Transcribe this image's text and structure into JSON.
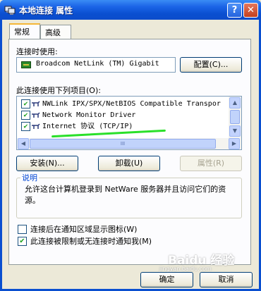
{
  "window": {
    "title": "本地连接 属性",
    "help_glyph": "?",
    "close_glyph": "✕"
  },
  "tabs": [
    {
      "label": "常规",
      "active": true
    },
    {
      "label": "高级",
      "active": false
    }
  ],
  "connect_using": {
    "label": "连接时使用:",
    "device_name": "Broadcom NetLink (TM) Gigabit",
    "configure_button": "配置(C)..."
  },
  "items": {
    "label": "此连接使用下列项目(O):",
    "list": [
      {
        "checked": true,
        "text": "NWLink IPX/SPX/NetBIOS Compatible Transpor"
      },
      {
        "checked": true,
        "text": "Network Monitor Driver"
      },
      {
        "checked": true,
        "text": "Internet 协议 (TCP/IP)"
      }
    ]
  },
  "scroll": {
    "up": "▲",
    "down": "▼",
    "left": "◀",
    "right": "▶",
    "grip": "III"
  },
  "buttons": {
    "install": "安装(N)...",
    "uninstall": "卸载(U)",
    "properties": "属性(R)"
  },
  "description": {
    "title": "说明",
    "text": "允许这台计算机登录到 NetWare 服务器并且访问它们的资源。"
  },
  "options": [
    {
      "checked": false,
      "label": "连接后在通知区域显示图标(W)"
    },
    {
      "checked": true,
      "label": "此连接被限制或无连接时通知我(M)"
    }
  ],
  "footer": {
    "ok": "确定",
    "cancel": "取消"
  },
  "watermark": {
    "text": "Baidu 经验",
    "url": "jingyan.baidu.com"
  },
  "colors": {
    "titlebar": "#0a4fd0",
    "annotation": "#2ae02a",
    "group_title": "#0046d5"
  }
}
